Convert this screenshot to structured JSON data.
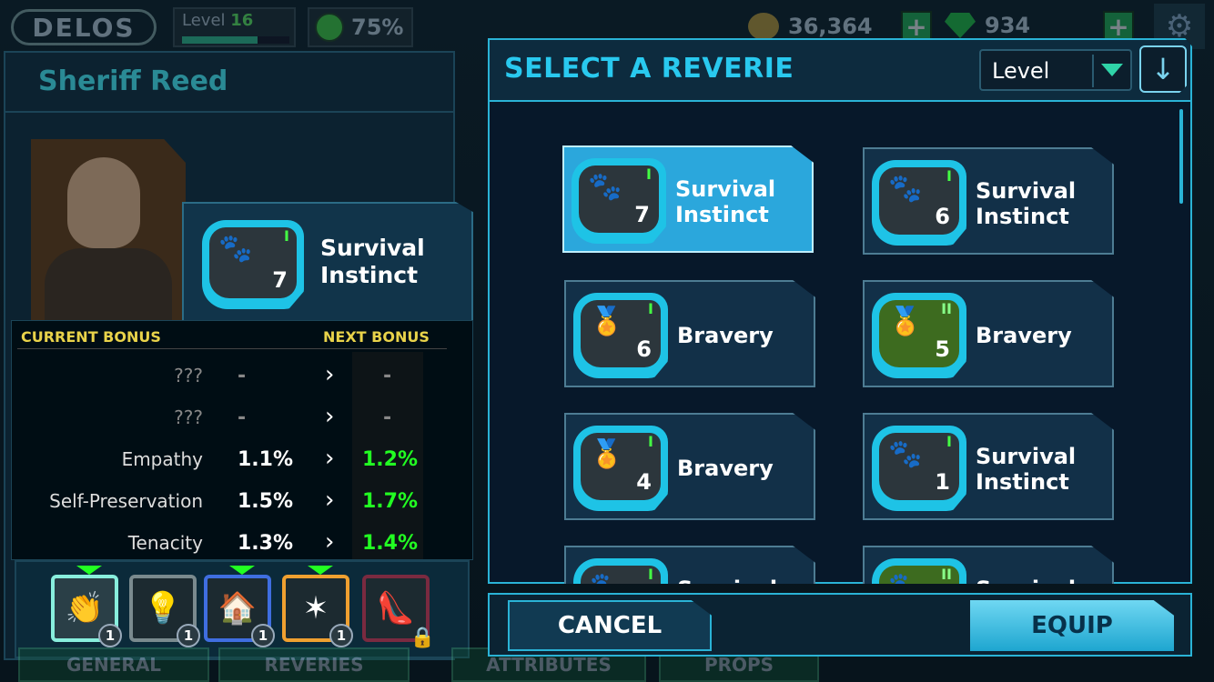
{
  "top_bar": {
    "logo": "DELOS",
    "level_label": "Level",
    "level_value": "16",
    "happiness": "75%",
    "coins": "36,364",
    "gems": "934",
    "plus": "+",
    "settings_icon": "gear-icon"
  },
  "character": {
    "name": "Sheriff Reed"
  },
  "featured_reverie": {
    "name": "Survival Instinct",
    "level": "7",
    "tier": "I",
    "icon": "paw-head-icon"
  },
  "bonus_table": {
    "current_header": "CURRENT BONUS",
    "next_header": "NEXT BONUS",
    "rows": [
      {
        "name": "???",
        "current": "-",
        "next": "-"
      },
      {
        "name": "???",
        "current": "-",
        "next": "-"
      },
      {
        "name": "Empathy",
        "current": "1.1%",
        "next": "1.2%"
      },
      {
        "name": "Self-Preservation",
        "current": "1.5%",
        "next": "1.7%"
      },
      {
        "name": "Tenacity",
        "current": "1.3%",
        "next": "1.4%"
      }
    ],
    "arrow": "›"
  },
  "slots": [
    {
      "icon": "hands-icon",
      "count": "1"
    },
    {
      "icon": "lightbulb-icon",
      "count": "1"
    },
    {
      "icon": "home-hand-icon",
      "count": "1"
    },
    {
      "icon": "sheriff-star-icon",
      "count": "1"
    },
    {
      "icon": "heel-shoe-icon",
      "locked": true
    }
  ],
  "bottom_tabs": [
    "GENERAL",
    "REVERIES",
    "ATTRIBUTES",
    "PROPS"
  ],
  "modal": {
    "title": "SELECT A REVERIE",
    "sort_value": "Level",
    "sort_direction_icon": "arrow-down-icon",
    "cards": [
      {
        "name": "Survival Instinct",
        "level": "7",
        "tier": "I",
        "icon": "paw-head-icon",
        "selected": true
      },
      {
        "name": "Survival Instinct",
        "level": "6",
        "tier": "I",
        "icon": "paw-head-icon"
      },
      {
        "name": "Bravery",
        "level": "6",
        "tier": "I",
        "icon": "medal-icon"
      },
      {
        "name": "Bravery",
        "level": "5",
        "tier": "II",
        "icon": "medal-icon",
        "green": true
      },
      {
        "name": "Bravery",
        "level": "4",
        "tier": "I",
        "icon": "medal-icon"
      },
      {
        "name": "Survival Instinct",
        "level": "1",
        "tier": "I",
        "icon": "paw-head-icon"
      },
      {
        "name": "Survival Instinct",
        "level": "",
        "tier": "I",
        "icon": "paw-head-icon"
      },
      {
        "name": "Survival Instinct",
        "level": "",
        "tier": "II",
        "icon": "paw-head-icon",
        "green": true
      }
    ]
  },
  "buttons": {
    "cancel": "CANCEL",
    "equip": "EQUIP"
  }
}
